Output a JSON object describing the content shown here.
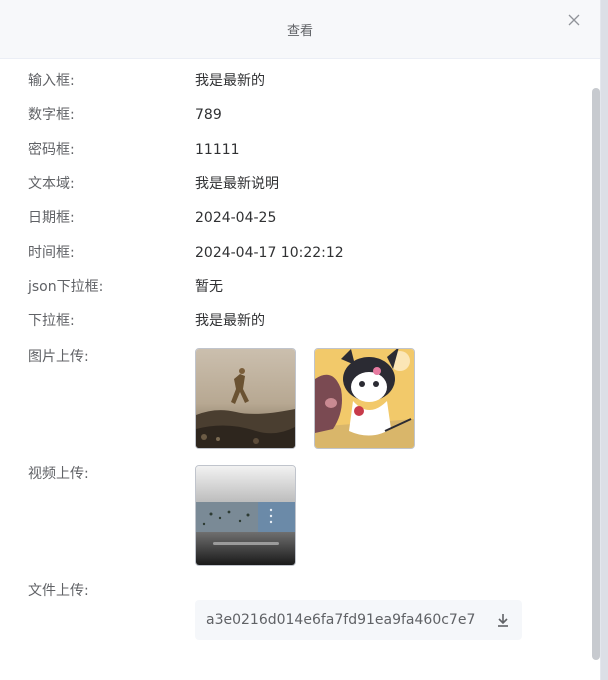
{
  "dialog": {
    "title": "查看",
    "close_icon": "close-icon"
  },
  "fields": [
    {
      "label": "输入框:",
      "value": "我是最新的"
    },
    {
      "label": "数字框:",
      "value": "789"
    },
    {
      "label": "密码框:",
      "value": "11111"
    },
    {
      "label": "文本域:",
      "value": "我是最新说明"
    },
    {
      "label": "日期框:",
      "value": "2024-04-25"
    },
    {
      "label": "时间框:",
      "value": "2024-04-17 10:22:12"
    },
    {
      "label": "json下拉框:",
      "value": "暂无"
    },
    {
      "label": "下拉框:",
      "value": "我是最新的"
    }
  ],
  "image_upload": {
    "label": "图片上传:",
    "images": [
      "landscape-photo",
      "kuromi-cartoon"
    ]
  },
  "video_upload": {
    "label": "视频上传:",
    "video": "video-thumbnail"
  },
  "file_upload": {
    "label": "文件上传:",
    "file_name": "a3e0216d014e6fa7fd91ea9fa460c7e7",
    "download_icon": "download-icon"
  },
  "colors": {
    "label": "#606266",
    "value": "#303133",
    "header_bg": "#f7f8fa",
    "file_bg": "#f5f7fa"
  }
}
